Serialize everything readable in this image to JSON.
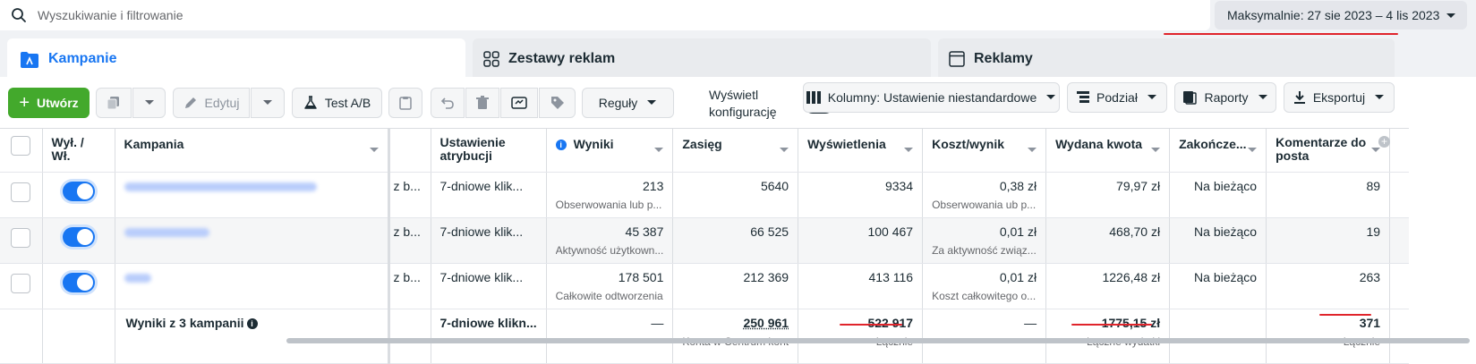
{
  "search": {
    "placeholder": "Wyszukiwanie i filtrowanie"
  },
  "date_range": {
    "label": "Maksymalnie: 27 sie 2023 – 4 lis 2023"
  },
  "tabs": [
    {
      "label": "Kampanie",
      "icon": "folder-icon",
      "active": true
    },
    {
      "label": "Zestawy reklam",
      "icon": "grid-icon",
      "active": false
    },
    {
      "label": "Reklamy",
      "icon": "ad-window-icon",
      "active": false
    }
  ],
  "toolbar": {
    "create_label": "Utwórz",
    "edit_label": "Edytuj",
    "ab_test_label": "Test A/B",
    "rules_label": "Reguły",
    "config_label_1": "Wyświetl",
    "config_label_2": "konfigurację",
    "columns_label": "Kolumny: Ustawienie niestandardowe",
    "breakdown_label": "Podział",
    "reports_label": "Raporty",
    "export_label": "Eksportuj"
  },
  "table": {
    "headers": {
      "toggle": "Wył. / Wł.",
      "campaign": "Kampania",
      "attribution": "Ustawienie atrybucji",
      "results": "Wyniki",
      "reach": "Zasięg",
      "impressions": "Wyświetlenia",
      "cost_per_result": "Koszt/wynik",
      "amount_spent": "Wydana kwota",
      "ends": "Zakończe...",
      "post_comments": "Komentarze do posta"
    },
    "rows": [
      {
        "budget": "z b...",
        "attribution": "7-dniowe klik...",
        "results": "213",
        "results_sub": "Obserwowania lub p...",
        "reach": "5640",
        "impressions": "9334",
        "cost": "0,38 zł",
        "cost_sub": "Obserwowania ub p...",
        "spent": "79,97 zł",
        "ends": "Na bieżąco",
        "comments": "89"
      },
      {
        "budget": "z b...",
        "attribution": "7-dniowe klik...",
        "results": "45 387",
        "results_sub": "Aktywność użytkown...",
        "reach": "66 525",
        "impressions": "100 467",
        "cost": "0,01 zł",
        "cost_sub": "Za aktywność związ...",
        "spent": "468,70 zł",
        "ends": "Na bieżąco",
        "comments": "19"
      },
      {
        "budget": "z b...",
        "attribution": "7-dniowe klik...",
        "results": "178 501",
        "results_sub": "Całkowite odtworzenia",
        "reach": "212 369",
        "impressions": "413 116",
        "cost": "0,01 zł",
        "cost_sub": "Koszt całkowitego o...",
        "spent": "1226,48 zł",
        "ends": "Na bieżąco",
        "comments": "263"
      }
    ],
    "totals": {
      "label": "Wyniki z 3 kampanii",
      "attribution": "7-dniowe klikn...",
      "results": "—",
      "reach": "250 961",
      "reach_sub": "Konta w Centrum kont",
      "impressions": "522 917",
      "impressions_sub": "Łącznie",
      "cost": "—",
      "spent": "1775,15 zł",
      "spent_sub": "Łączne wydatki",
      "comments": "371",
      "comments_sub": "Łącznie"
    }
  },
  "colors": {
    "accent": "#1876f2",
    "create": "#43a92c",
    "annotation": "#e0242b"
  }
}
